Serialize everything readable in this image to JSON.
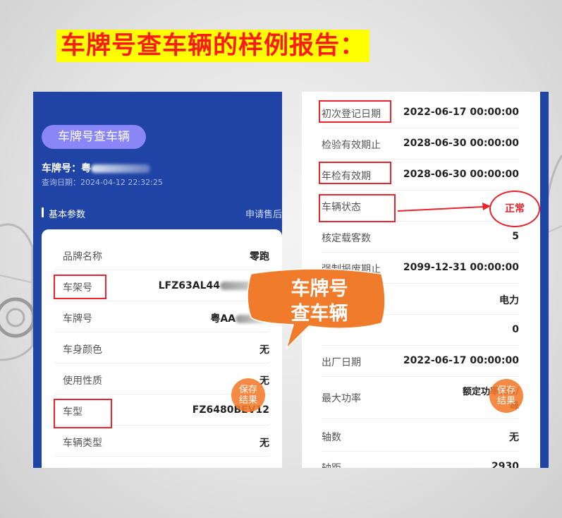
{
  "headline": "车牌号查车辆的样例报告：",
  "left": {
    "pill": "车牌号查车辆",
    "plate_label": "车牌号：",
    "plate_prefix": "粤",
    "query_date": "查询日期：2024-04-12 22:32:25",
    "section_title": "基本参数",
    "section_link": "申请售后",
    "rows": [
      {
        "label": "品牌名称",
        "value": "零跑"
      },
      {
        "label": "车架号",
        "value": "LFZ63AL44"
      },
      {
        "label": "车牌号",
        "value": "粤AA"
      },
      {
        "label": "车身颜色",
        "value": "无"
      },
      {
        "label": "使用性质",
        "value": "无"
      },
      {
        "label": "车型",
        "value": "FZ6480BEV12"
      },
      {
        "label": "车辆类型",
        "value": "无"
      }
    ],
    "fab": [
      "保存",
      "结果"
    ]
  },
  "right": {
    "rows": [
      {
        "label": "初次登记日期",
        "value": "2022-06-17 00:00:00"
      },
      {
        "label": "检验有效期止",
        "value": "2028-06-30 00:00:00"
      },
      {
        "label": "年检有效期",
        "value": "2028-06-30 00:00:00"
      },
      {
        "label": "车辆状态",
        "value": ""
      },
      {
        "label": "核定载客数",
        "value": "5"
      },
      {
        "label": "强制报废期止",
        "value": "2099-12-31 00:00:00"
      },
      {
        "label": "",
        "value": "电力"
      },
      {
        "label": "",
        "value": "0"
      },
      {
        "label": "出厂日期",
        "value": "2022-06-17 00:00:00"
      },
      {
        "label": "最大功率",
        "value": "额定功率:85/",
        "value2": "峰"
      },
      {
        "label": "轴数",
        "value": "无"
      },
      {
        "label": "轴距",
        "value": "2930"
      }
    ],
    "fab": [
      "保存",
      "结果"
    ]
  },
  "annotations": {
    "status_note": "正常",
    "bubble_line1": "车牌号",
    "bubble_line2": "查车辆"
  },
  "colors": {
    "headline_bg": "#ffff00",
    "headline_text": "#ff1a1a",
    "panel_blue": "#1f44a6",
    "pill": "#8a86f7",
    "highlight_red": "#e8242c",
    "callout_orange": "#f07b2b"
  }
}
